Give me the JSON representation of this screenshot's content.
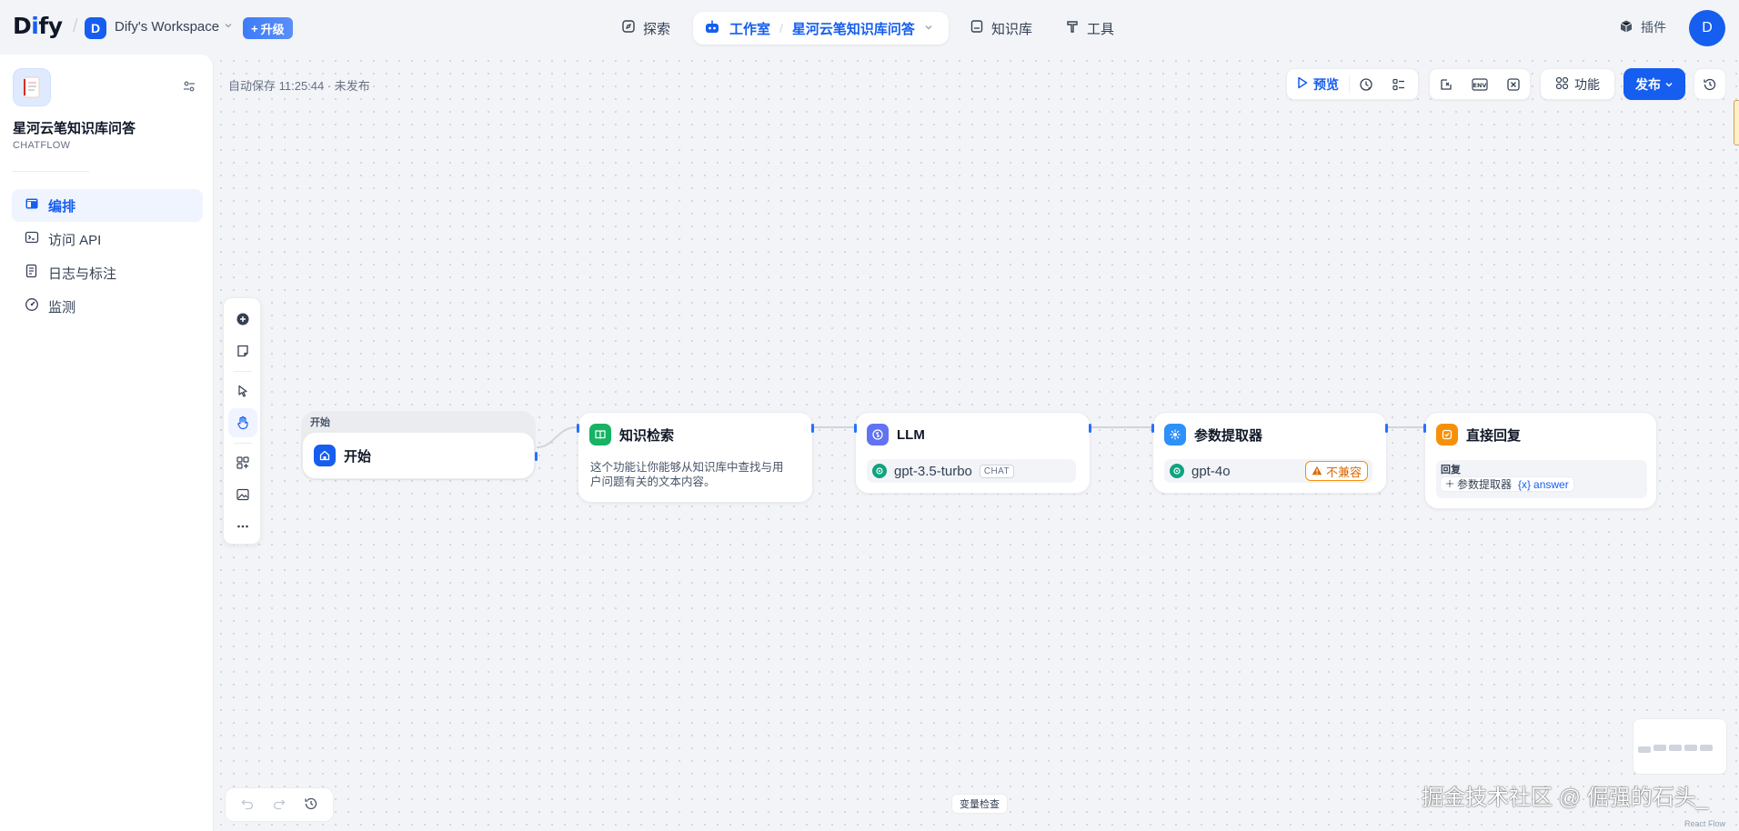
{
  "header": {
    "logo": "Dify",
    "workspace": {
      "avatar_letter": "D",
      "name": "Dify's Workspace"
    },
    "upgrade_label": "升级",
    "nav": {
      "explore": "探索",
      "studio": "工作室",
      "current_app": "星河云笔知识库问答",
      "knowledge": "知识库",
      "tools": "工具"
    },
    "plugins_label": "插件",
    "user_avatar_letter": "D"
  },
  "sidebar": {
    "app_title": "星河云笔知识库问答",
    "app_mode": "CHATFLOW",
    "items": [
      {
        "label": "编排",
        "icon": "layout-icon",
        "active": true
      },
      {
        "label": "访问 API",
        "icon": "terminal-icon",
        "active": false
      },
      {
        "label": "日志与标注",
        "icon": "file-list-icon",
        "active": false
      },
      {
        "label": "监测",
        "icon": "gauge-icon",
        "active": false
      }
    ]
  },
  "canvas": {
    "autosave_text": "自动保存 11:25:44 · 未发布",
    "toolbar": {
      "preview_label": "预览",
      "features_label": "功能",
      "publish_label": "发布"
    },
    "nodes": {
      "start": {
        "caption": "开始",
        "title": "开始"
      },
      "knowledge": {
        "title": "知识检索",
        "desc_line1": "这个功能让你能够从知识库中查找与用",
        "desc_line2": "户问题有关的文本内容。"
      },
      "llm": {
        "title": "LLM",
        "model": "gpt-3.5-turbo",
        "model_tag": "CHAT"
      },
      "extractor": {
        "title": "参数提取器",
        "model": "gpt-4o",
        "warning": "不兼容"
      },
      "answer": {
        "title": "直接回复",
        "field_label": "回复",
        "var_node": "参数提取器",
        "var_name": "answer",
        "var_prefix": "{x}"
      }
    },
    "variable_check_label": "变量检查",
    "react_flow_label": "React Flow"
  },
  "watermark": "掘金技术社区 @ 倔强的石头_",
  "colors": {
    "primary": "#155eef",
    "llm": "#6172f3",
    "knowledge": "#16b364",
    "extractor": "#2e90fa",
    "answer": "#f79009",
    "warning": "#dc6803"
  }
}
